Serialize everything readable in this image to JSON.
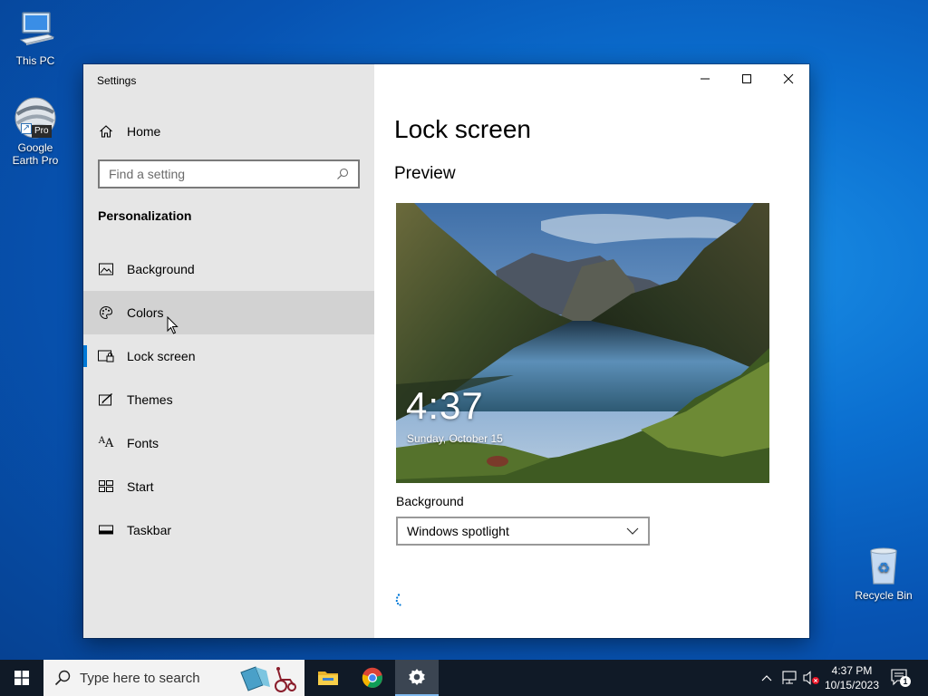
{
  "desktop": {
    "this_pc_label": "This PC",
    "google_earth_label": "Google Earth Pro",
    "google_earth_badge": "Pro",
    "recycle_bin_label": "Recycle Bin"
  },
  "window": {
    "title": "Settings",
    "sidebar": {
      "home_label": "Home",
      "search_placeholder": "Find a setting",
      "section_heading": "Personalization",
      "items": [
        {
          "label": "Background",
          "icon": "picture-icon"
        },
        {
          "label": "Colors",
          "icon": "palette-icon"
        },
        {
          "label": "Lock screen",
          "icon": "lock-screen-icon"
        },
        {
          "label": "Themes",
          "icon": "themes-icon"
        },
        {
          "label": "Fonts",
          "icon": "fonts-icon"
        },
        {
          "label": "Start",
          "icon": "start-icon"
        },
        {
          "label": "Taskbar",
          "icon": "taskbar-icon"
        }
      ],
      "active_item": "Lock screen",
      "hovered_item": "Colors"
    },
    "content": {
      "page_title": "Lock screen",
      "preview_heading": "Preview",
      "preview_time": "4:37",
      "preview_date": "Sunday, October 15",
      "background_label": "Background",
      "background_value": "Windows spotlight"
    }
  },
  "taskbar": {
    "search_placeholder": "Type here to search",
    "time": "4:37 PM",
    "date": "10/15/2023",
    "notification_count": "1"
  },
  "colors": {
    "accent": "#0078d7",
    "sidebar_bg": "#e6e6e6",
    "taskbar_bg": "#101a27"
  }
}
